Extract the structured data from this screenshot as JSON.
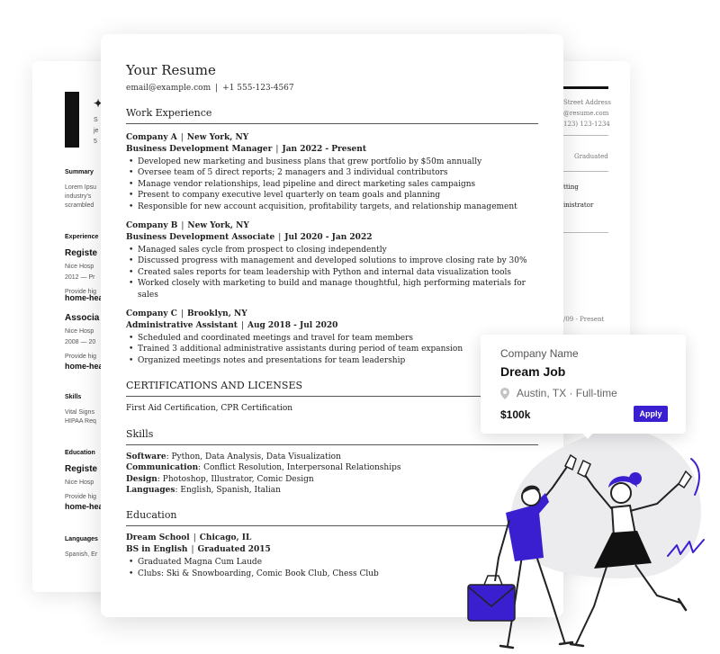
{
  "resume": {
    "name": "Your Resume",
    "email": "email@example.com",
    "phone": "+1 555-123-4567",
    "sections": {
      "work": "Work Experience",
      "certs": "CERTIFICATIONS AND LICENSES",
      "skills": "Skills",
      "education": "Education"
    },
    "jobs": [
      {
        "company": "Company A",
        "location": "New York, NY",
        "title": "Business Development Manager",
        "dates": "Jan 2022 - Present",
        "bullets": [
          "Developed new marketing and business plans that grew portfolio by $50m annually",
          "Oversee team of 5 direct reports; 2 managers and 3 individual contributors",
          "Manage vendor relationships, lead pipeline and direct marketing sales campaigns",
          "Present to company executive level quarterly on team goals and planning",
          "Responsible for new account acquisition, profitability targets, and relationship management"
        ]
      },
      {
        "company": "Company B",
        "location": "New York, NY",
        "title": "Business Development Associate",
        "dates": "Jul 2020 - Jan 2022",
        "bullets": [
          "Managed sales cycle from prospect to closing independently",
          "Discussed progress with management and developed solutions to improve closing rate by 30%",
          "Created sales reports for team leadership with Python and internal data visualization tools",
          "Worked closely with marketing to build and manage thoughtful, high performing materials for sales"
        ]
      },
      {
        "company": "Company C",
        "location": "Brooklyn, NY",
        "title": "Administrative Assistant",
        "dates": "Aug 2018 - Jul 2020",
        "bullets": [
          "Scheduled and coordinated meetings and travel for team members",
          "Trained 3 additional administrative assistants during period of team expansion",
          "Organized meetings notes and presentations for team leadership"
        ]
      }
    ],
    "certifications": "First Aid Certification, CPR Certification",
    "skills": [
      {
        "label": "Software",
        "value": "Python, Data Analysis, Data Visualization"
      },
      {
        "label": "Communication",
        "value": "Conflict Resolution, Interpersonal Relationships"
      },
      {
        "label": "Design",
        "value": "Photoshop, Illustrator, Comic Design"
      },
      {
        "label": "Languages",
        "value": "English, Spanish, Italian"
      }
    ],
    "education": {
      "school": "Dream School",
      "location": "Chicago, IL",
      "degree": "BS in English",
      "graduated": "Graduated 2015",
      "bullets": [
        "Graduated Magna Cum Laude",
        "Clubs: Ski & Snowboarding, Comic Book Club, Chess Club"
      ]
    }
  },
  "back_left": {
    "mini_lines": [
      "S",
      "je",
      "5"
    ],
    "summary_heading": "Summary",
    "summary_lines": [
      "Lorem Ipsu",
      "industry's",
      "scrambled"
    ],
    "experience_heading": "Experience",
    "job1_title": "Registe",
    "job1_lines": [
      "Nice Hosp",
      "2012 — Pr",
      "Provide hig",
      "home-hea"
    ],
    "job2_title": "Associa",
    "job2_lines": [
      "Nice Hosp",
      "2008 — 20",
      "Provide hig",
      "home-heal"
    ],
    "skills_heading": "Skills",
    "skills_lines": [
      "Vital Signs",
      "HIPAA Req"
    ],
    "education_heading": "Education",
    "edu_title": "Registe",
    "edu_lines": [
      "Nice Hosp",
      "Provide hig",
      "home-heal"
    ],
    "languages_heading": "Languages",
    "languages_line": "Spanish, Er"
  },
  "back_right": {
    "contact_lines": [
      "Street Address",
      "@resume.com",
      "123) 123-1234"
    ],
    "graduated": "Graduated",
    "lines": [
      "tting",
      "inistrator"
    ],
    "date": "/09 - Present"
  },
  "job_card": {
    "company": "Company Name",
    "title": "Dream Job",
    "location": "Austin, TX · Full-time",
    "salary": "$100k",
    "apply_label": "Apply"
  },
  "colors": {
    "accent": "#3a1fd0",
    "ink": "#222222",
    "illustration_gray": "#ececef"
  },
  "icons": {
    "location": "location-pin-icon"
  }
}
